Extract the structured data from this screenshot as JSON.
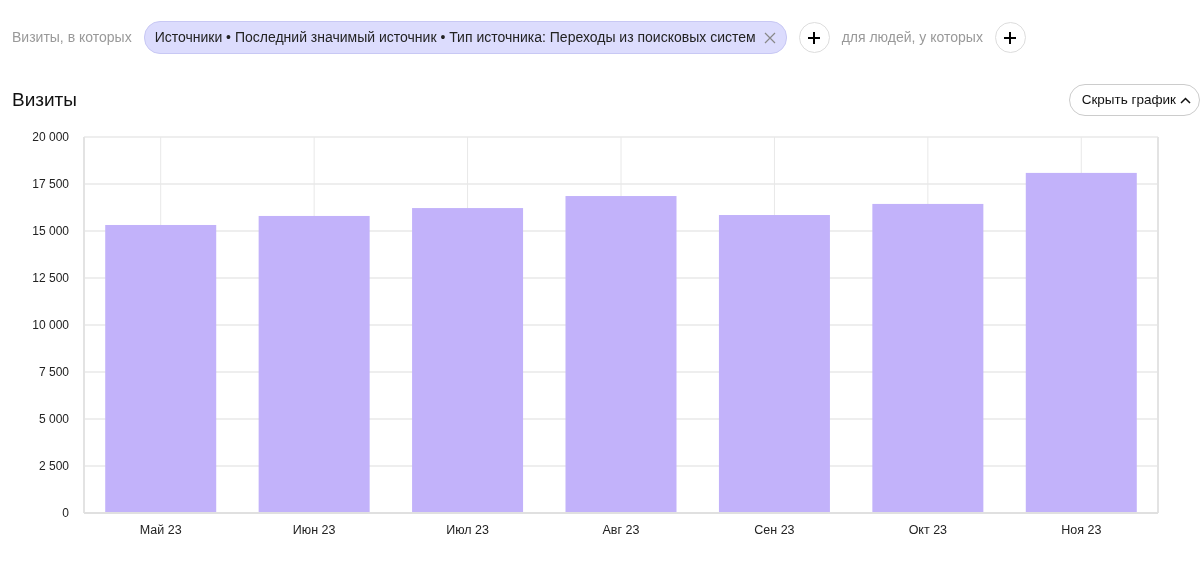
{
  "filter": {
    "prefix": "Визиты, в которых",
    "chip": "Источники • Последний значимый источник • Тип источника: Переходы из поисковых систем",
    "people_label": "для людей, у которых"
  },
  "section": {
    "title": "Визиты",
    "toggle_button": "Скрыть график"
  },
  "chart_data": {
    "type": "bar",
    "categories": [
      "Май 23",
      "Июн 23",
      "Июл 23",
      "Авг 23",
      "Сен 23",
      "Окт 23",
      "Ноя 23"
    ],
    "grid": true,
    "series": [
      {
        "color": "#c2b2fa",
        "values": [
          15320,
          15800,
          16220,
          16860,
          15850,
          16440,
          18090
        ]
      }
    ],
    "ylim": [
      0,
      20000
    ],
    "yticks": [
      {
        "value": 0,
        "label": "0"
      },
      {
        "value": 2500,
        "label": "2 500"
      },
      {
        "value": 5000,
        "label": "5 000"
      },
      {
        "value": 7500,
        "label": "7 500"
      },
      {
        "value": 10000,
        "label": "10 000"
      },
      {
        "value": 12500,
        "label": "12 500"
      },
      {
        "value": 15000,
        "label": "15 000"
      },
      {
        "value": 17500,
        "label": "17 500"
      },
      {
        "value": 20000,
        "label": "20 000"
      }
    ]
  }
}
